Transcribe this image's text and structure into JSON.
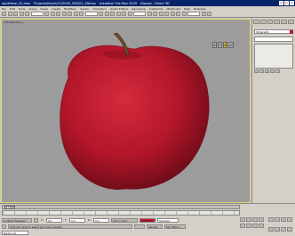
{
  "window": {
    "title_file": "applefinal_02.max",
    "title_project": "Projects\\Maya\\CG\\2009_3DS\\02_3Dmax",
    "title_app": "Autodesk 3ds Max 2009",
    "title_display": "Display : Direct 3D"
  },
  "menu": [
    "File",
    "Edit",
    "Tools",
    "Group",
    "Views",
    "Create",
    "Modifiers",
    "reactor",
    "Animation",
    "Graph Editors",
    "Rendering",
    "Customize",
    "MAXScript",
    "Help",
    "Tentacles"
  ],
  "viewport": {
    "label": "[ Perspective ]",
    "viewcube": [
      "X",
      "Y",
      "Z",
      "XY"
    ],
    "viewcube_active": "Z",
    "colors": {
      "apple": "#b3162a",
      "stem": "#6b4a2a",
      "background": "#9c9c9c",
      "border": "#e3d76a"
    }
  },
  "command_panel": {
    "object_name": "Sphere01",
    "object_color": "#c8102e"
  },
  "timeline": {
    "frame_label": "0 / 100"
  },
  "status": {
    "row1": [
      "1 Object Selected"
    ],
    "row1_coords": [
      "X:",
      "0.0",
      "Y:",
      "0.0",
      "Z:",
      "0.0"
    ],
    "row1_grid": "Grid = 10.0",
    "row1_key": "Auto Key",
    "row1_selected": "Selected",
    "row2_msg": "Click and drag to select and move objects",
    "row2_key": "Set Key",
    "row2_filters": "Key Filters...",
    "row3_script": "MAXScript"
  }
}
